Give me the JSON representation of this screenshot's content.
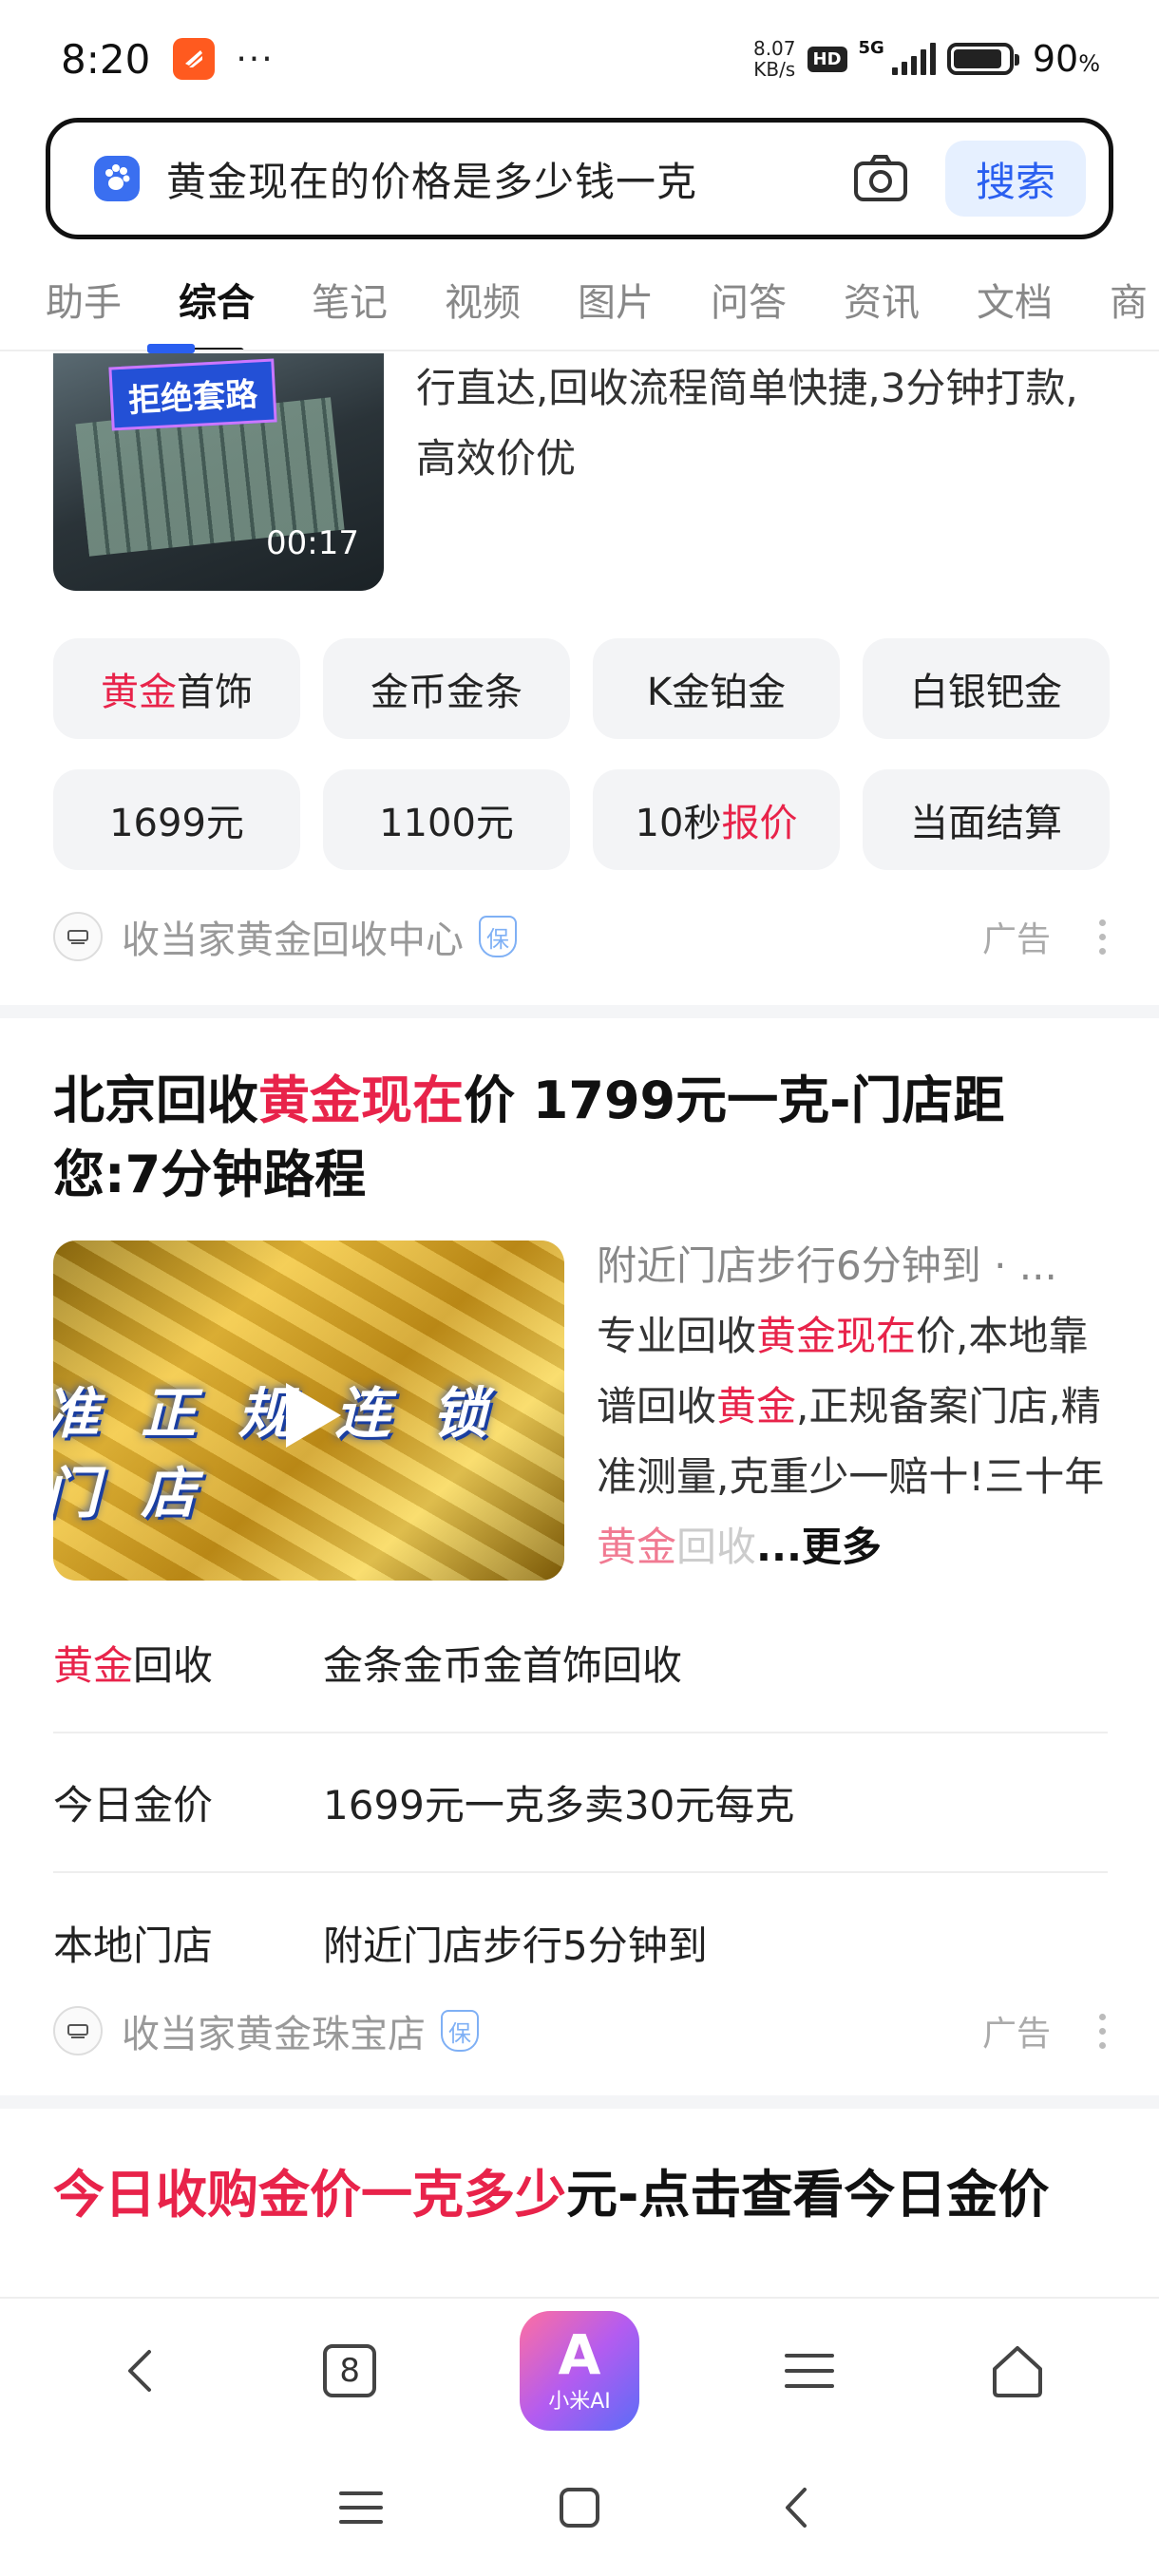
{
  "status_bar": {
    "time": "8:20",
    "more": "···",
    "net_speed_value": "8.07",
    "net_speed_unit": "KB/s",
    "hd": "HD",
    "network": "5G",
    "battery_percent": "90",
    "battery_unit": "%"
  },
  "search": {
    "query": "黄金现在的价格是多少钱一克",
    "button": "搜索"
  },
  "tabs": [
    {
      "label": "助手",
      "active": false
    },
    {
      "label": "综合",
      "active": true
    },
    {
      "label": "笔记",
      "active": false
    },
    {
      "label": "视频",
      "active": false
    },
    {
      "label": "图片",
      "active": false
    },
    {
      "label": "问答",
      "active": false
    },
    {
      "label": "资讯",
      "active": false
    },
    {
      "label": "文档",
      "active": false
    },
    {
      "label": "商",
      "active": false
    }
  ],
  "card1": {
    "thumb_banner": "拒绝套路",
    "duration": "00:17",
    "description": "行直达,回收流程简单快捷,3分钟打款,高效价优",
    "chips": [
      {
        "highlight": "黄金",
        "text": "首饰"
      },
      {
        "highlight": "",
        "text": "金币金条"
      },
      {
        "highlight": "",
        "text": "K金铂金"
      },
      {
        "highlight": "",
        "text": "白银钯金"
      },
      {
        "highlight": "",
        "text": "1699元"
      },
      {
        "highlight": "",
        "text": "1100元"
      },
      {
        "prefix": "10秒",
        "highlight": "报价",
        "text": ""
      },
      {
        "highlight": "",
        "text": "当面结算"
      }
    ],
    "source": "收当家黄金回收中心",
    "guarantee": "保",
    "ad_label": "广告"
  },
  "card2": {
    "title_part1": "北京回收",
    "title_highlight": "黄金现在",
    "title_part2": "价 1799元一克-门店距您:7分钟路程",
    "thumb_banner": "准 正 规 连 锁 门 店",
    "desc_sub": "附近门店步行6分钟到 · ...",
    "desc_1": "专业回收",
    "desc_hl1": "黄金现在",
    "desc_2": "价,本地靠谱回收",
    "desc_hl2": "黄金",
    "desc_3": ",正规备案门店,精准测量,克重少一赔十!三十年",
    "desc_hl3": "黄金",
    "desc_fade": "回收",
    "desc_more": "...更多",
    "rows": [
      {
        "key_highlight": "黄金",
        "key": "回收",
        "value": "金条金币金首饰回收"
      },
      {
        "key_highlight": "",
        "key": "今日金价",
        "value": "1699元一克多卖30元每克"
      },
      {
        "key_highlight": "",
        "key": "本地门店",
        "value": "附近门店步行5分钟到"
      }
    ],
    "source": "收当家黄金珠宝店",
    "guarantee": "保",
    "ad_label": "广告"
  },
  "card3": {
    "title_highlight": "今日收购金价一克多少",
    "title_rest": "元-点击查看今日金价"
  },
  "browser_bar": {
    "tab_count": "8",
    "ai_logo": "A",
    "ai_label": "小米AI"
  }
}
